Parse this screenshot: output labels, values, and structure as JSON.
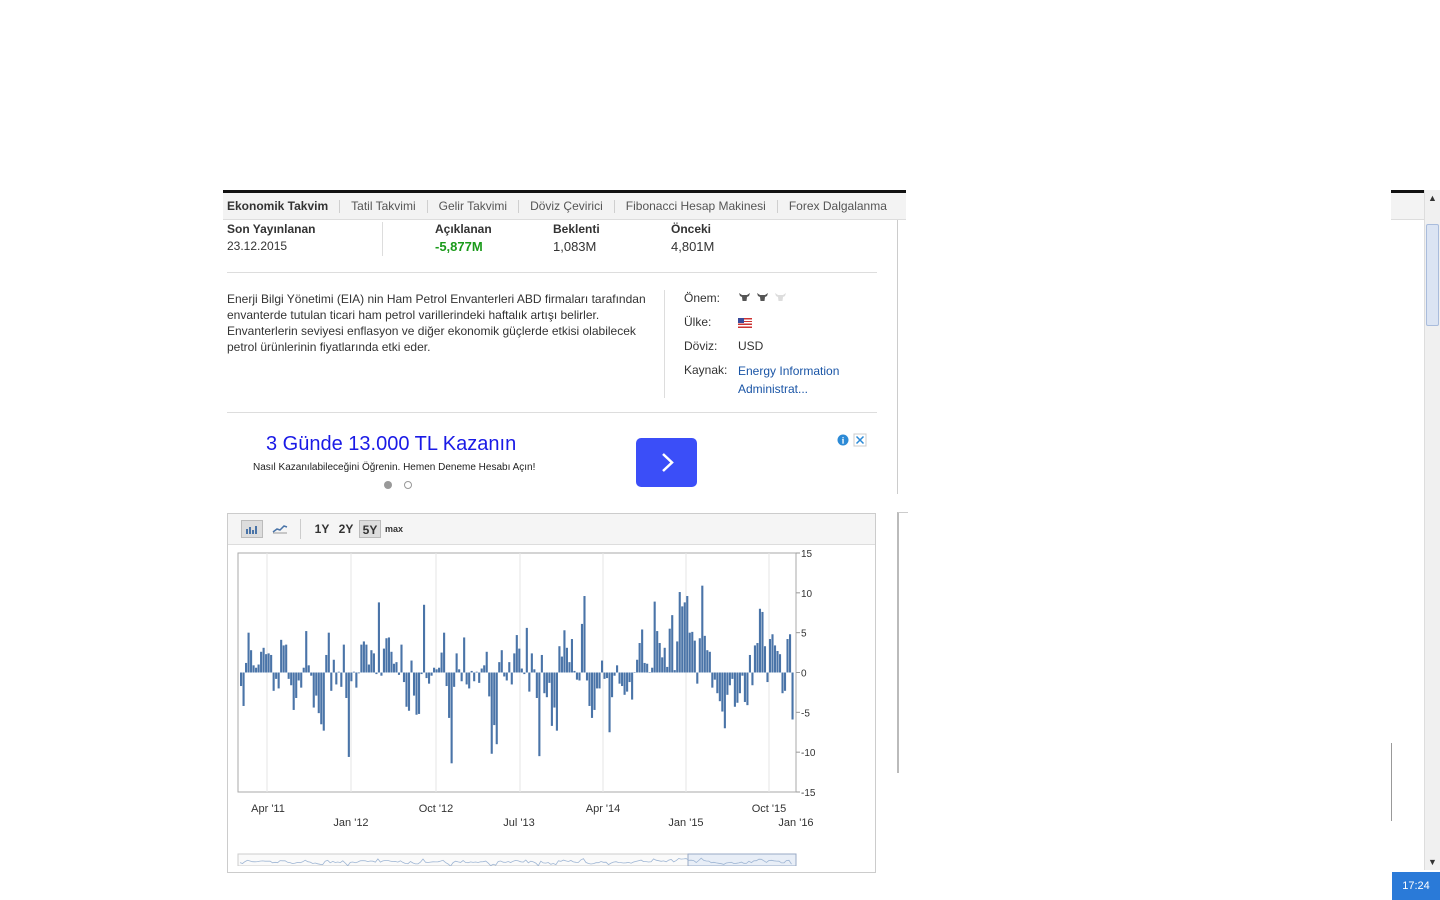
{
  "nav": {
    "items": [
      "Ekonomik Takvim",
      "Tatil Takvimi",
      "Gelir Takvimi",
      "Döviz Çevirici",
      "Fibonacci Hesap Makinesi",
      "Forex Dalgalanma"
    ]
  },
  "stats": {
    "latest_label": "Son Yayınlanan",
    "latest_date": "23.12.2015",
    "actual_label": "Açıklanan",
    "actual_value": "-5,877M",
    "forecast_label": "Beklenti",
    "forecast_value": "1,083M",
    "previous_label": "Önceki",
    "previous_value": "4,801M",
    "actual_color": "#1a9a1a"
  },
  "description": "Enerji Bilgi Yönetimi (EIA) nin Ham Petrol Envanterleri ABD firmaları tarafından envanterde tutulan ticari ham petrol varillerindeki haftalık artışı belirler. Envanterlerin seviyesi enflasyon ve diğer ekonomik güçlerde etkisi olabilecek petrol ürünlerinin fiyatlarında etki eder.",
  "details": {
    "importance_label": "Önem:",
    "importance_level": 2,
    "importance_max": 3,
    "country_label": "Ülke:",
    "country_icon": "us-flag-icon",
    "currency_label": "Döviz:",
    "currency_value": "USD",
    "source_label": "Kaynak:",
    "source_value": "Energy Information Administrat..."
  },
  "ad": {
    "title": "3 Günde 13.000 TL Kazanın",
    "subtitle": "Nasıl Kazanılabileceğini Öğrenin. Hemen Deneme Hesabı Açın!",
    "button_icon": "chevron-right-icon",
    "button_color": "#3b4ef8",
    "slides": 2,
    "active_slide": 1
  },
  "chart_toolbar": {
    "bar_icon": "bar-chart-icon",
    "line_icon": "line-chart-icon",
    "ranges": [
      "1Y",
      "2Y",
      "5Y",
      "max"
    ],
    "active_range": "5Y"
  },
  "chart_data": {
    "type": "bar",
    "x_start": "2011-01-05",
    "x_end": "2015-12-23",
    "interval": "weekly",
    "ylim": [
      -15,
      15
    ],
    "yticks": [
      15,
      10,
      5,
      0,
      -5,
      -10,
      -15
    ],
    "xticks_top": [
      "Apr '11",
      "Oct '12",
      "Apr '14",
      "Oct '15"
    ],
    "xticks_bottom": [
      "Jan '12",
      "Jul '13",
      "Jan '15",
      "Jan '16"
    ],
    "color": "#4a74a8",
    "values": [
      -1.7,
      -4.2,
      1.2,
      5.0,
      2.8,
      0.9,
      0.6,
      1.0,
      2.6,
      3.1,
      2.3,
      2.4,
      2.2,
      -2.3,
      -0.8,
      -2.0,
      4.1,
      3.4,
      3.5,
      -0.8,
      -1.6,
      -4.7,
      -3.2,
      -1.0,
      -1.9,
      0.6,
      5.2,
      0.9,
      -0.4,
      -4.4,
      -2.9,
      -5.1,
      -6.5,
      -7.3,
      2.2,
      5.0,
      -2.3,
      1.6,
      -1.5,
      0.1,
      -1.8,
      3.5,
      -3.2,
      -10.6,
      -1.1,
      0.1,
      -1.9,
      -0.1,
      3.5,
      3.9,
      3.5,
      1.0,
      2.8,
      2.4,
      -0.2,
      8.8,
      -0.4,
      3.0,
      4.3,
      4.4,
      2.6,
      1.1,
      1.3,
      -0.3,
      3.5,
      -1.2,
      -4.3,
      -4.8,
      1.5,
      -2.9,
      -5.3,
      -5.2,
      -0.2,
      8.5,
      -0.7,
      -1.4,
      -0.4,
      0.6,
      0.4,
      0.6,
      2.5,
      5.0,
      -1.7,
      -5.7,
      -11.4,
      -1.8,
      2.4,
      0.4,
      -1.1,
      4.4,
      -1.5,
      -2.0,
      0.2,
      -1.1,
      0.1,
      -1.3,
      0.5,
      0.9,
      2.6,
      -3.0,
      -10.2,
      -6.6,
      -9.0,
      1.3,
      2.8,
      -0.5,
      -1.0,
      1.3,
      -1.5,
      2.4,
      4.7,
      3.0,
      0.5,
      -0.2,
      5.6,
      -2.4,
      2.4,
      0.4,
      -3.2,
      -10.5,
      2.2,
      -2.6,
      -3.1,
      -1.3,
      -6.7,
      -4.4,
      -7.3,
      3.3,
      2.0,
      5.3,
      3.1,
      1.3,
      4.2,
      0.2,
      -0.9,
      -1.0,
      6.1,
      9.6,
      -1.0,
      -4.2,
      -5.7,
      -4.7,
      -2.0,
      -2.0,
      1.5,
      -0.8,
      -0.7,
      -7.5,
      -3.1,
      -0.4,
      0.9,
      -1.4,
      -1.7,
      -2.8,
      -2.4,
      -1.2,
      -3.4,
      0.0,
      1.6,
      3.7,
      5.4,
      1.2,
      1.1,
      0.0,
      0.6,
      8.9,
      5.2,
      3.7,
      1.9,
      3.1,
      0.7,
      5.5,
      7.2,
      0.3,
      3.9,
      10.1,
      8.3,
      8.8,
      9.6,
      5.0,
      5.1,
      4.0,
      -1.4,
      4.3,
      10.9,
      4.6,
      2.8,
      2.6,
      -1.9,
      -0.9,
      -2.6,
      -3.6,
      -4.9,
      -7.0,
      -2.8,
      -1.6,
      -0.8,
      -4.3,
      -3.8,
      -2.6,
      -0.4,
      -3.7,
      -4.1,
      2.2,
      -1.6,
      3.4,
      3.7,
      8.0,
      7.6,
      3.3,
      -1.2,
      4.2,
      4.8,
      3.4,
      2.7,
      2.3,
      -2.6,
      -2.3,
      4.2,
      4.8,
      -5.9
    ]
  },
  "time": "17:24"
}
